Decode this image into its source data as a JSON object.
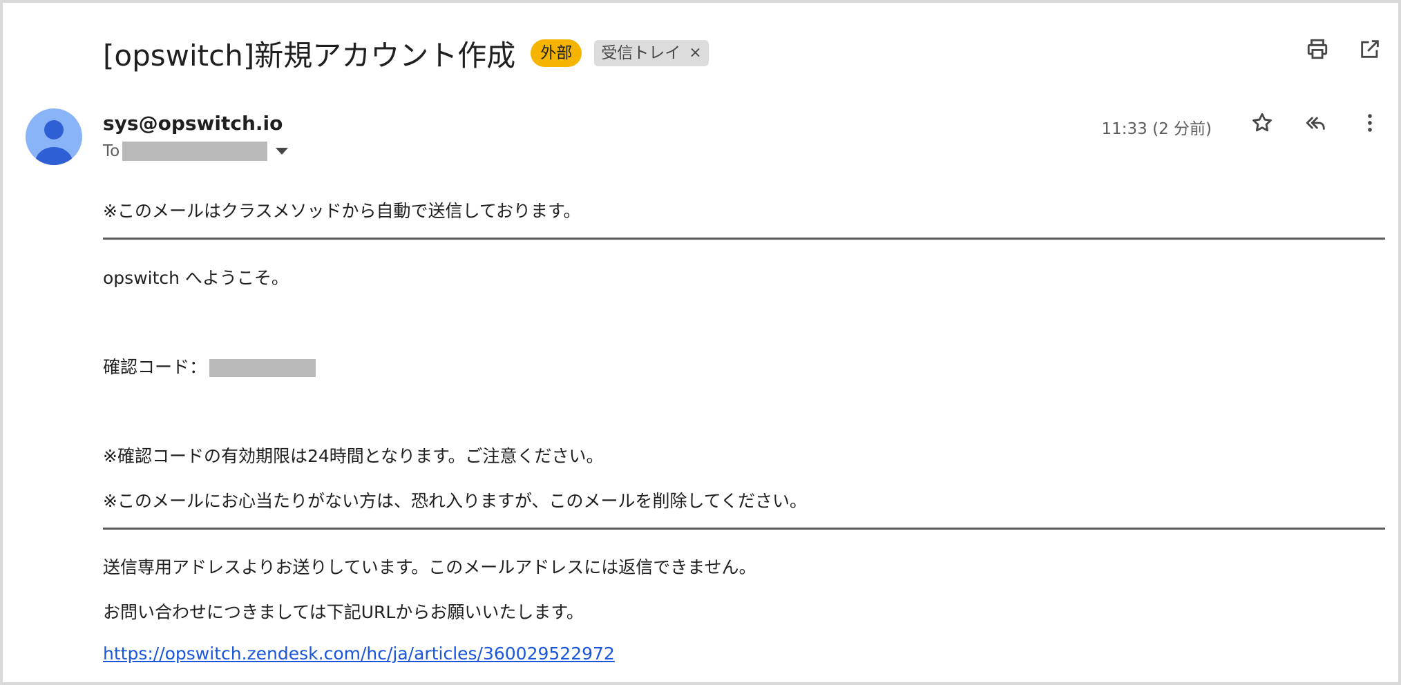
{
  "header": {
    "subject": "[opswitch]新規アカウント作成",
    "badge_external": "外部",
    "badge_inbox": "受信トレイ",
    "badge_remove": "×"
  },
  "message": {
    "sender": "sys@opswitch.io",
    "to_label": "To",
    "time": "11:33 (2 分前)"
  },
  "body": {
    "notice": "※このメールはクラスメソッドから自動で送信しております。",
    "welcome": "opswitch へようこそ。",
    "code_label": "確認コード：",
    "validity": "※確認コードの有効期限は24時間となります。ご注意ください。",
    "delete_notice": "※このメールにお心当たりがない方は、恐れ入りますが、このメールを削除してください。",
    "no_reply": "送信専用アドレスよりお送りしています。このメールアドレスには返信できません。",
    "contact": "お問い合わせにつきましては下記URLからお願いいたします。",
    "link": "https://opswitch.zendesk.com/hc/ja/articles/360029522972"
  },
  "icons": {
    "print": "print-icon",
    "open_new": "open-in-new-icon",
    "star": "star-icon",
    "reply_all": "reply-all-icon",
    "more": "more-vert-icon"
  },
  "colors": {
    "external_badge": "#f4b400",
    "inbox_badge": "#dcdcdc",
    "link": "#1a56db",
    "avatar": "#8ab4f8"
  }
}
